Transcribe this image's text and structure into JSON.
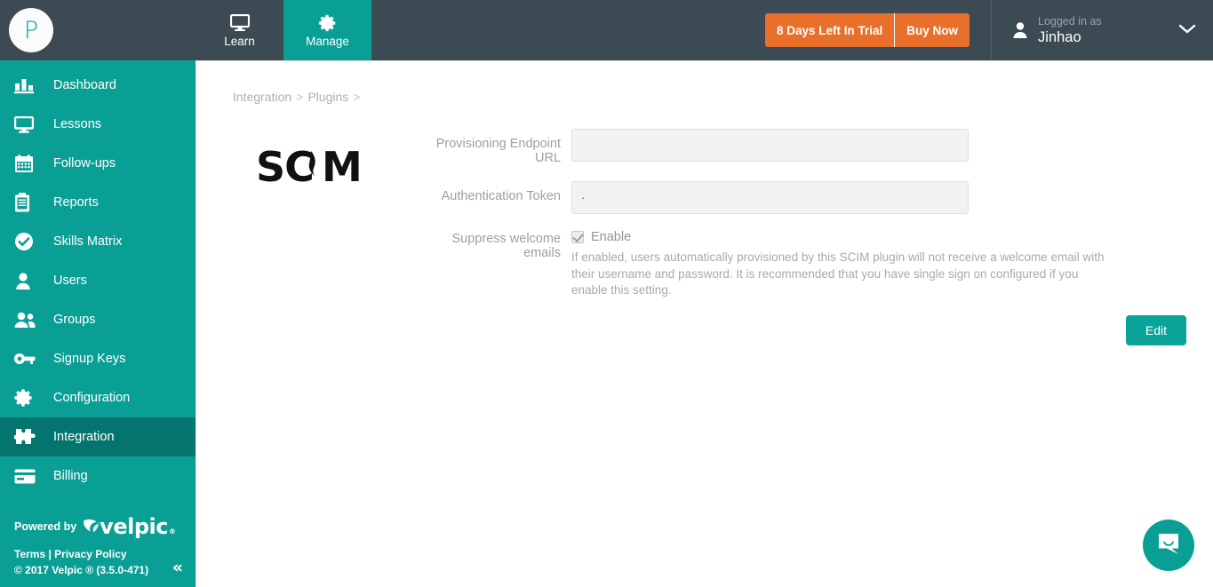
{
  "topbar": {
    "logo_letter": "P",
    "logo_name": "brand-logo-p",
    "nav": [
      {
        "label": "Learn",
        "icon": "monitor-icon",
        "active": false
      },
      {
        "label": "Manage",
        "icon": "gear-icon",
        "active": true
      }
    ],
    "trial": {
      "days_label": "8 Days Left In Trial",
      "buy_label": "Buy Now",
      "color": "#e8702a"
    },
    "user": {
      "logged_in_label": "Logged in as",
      "name": "Jinhao",
      "avatar_icon": "person-icon",
      "caret_icon": "chevron-down-icon"
    },
    "background_color": "#3c4b53"
  },
  "sidebar": {
    "accent_color": "#0a9f95",
    "active_color": "#04756e",
    "items": [
      {
        "label": "Dashboard",
        "icon": "bar-chart-icon",
        "active": false
      },
      {
        "label": "Lessons",
        "icon": "monitor-icon",
        "active": false
      },
      {
        "label": "Follow-ups",
        "icon": "calendar-icon",
        "active": false
      },
      {
        "label": "Reports",
        "icon": "clipboard-icon",
        "active": false
      },
      {
        "label": "Skills Matrix",
        "icon": "check-circle-icon",
        "active": false
      },
      {
        "label": "Users",
        "icon": "person-icon",
        "active": false
      },
      {
        "label": "Groups",
        "icon": "people-icon",
        "active": false
      },
      {
        "label": "Signup Keys",
        "icon": "key-icon",
        "active": false
      },
      {
        "label": "Configuration",
        "icon": "gear-icon",
        "active": false
      },
      {
        "label": "Integration",
        "icon": "puzzle-icon",
        "active": true
      },
      {
        "label": "Billing",
        "icon": "credit-card-icon",
        "active": false
      }
    ],
    "footer": {
      "powered_by": "Powered by",
      "brand": "velpic",
      "registered_mark": "®",
      "terms": "Terms",
      "links_separator": " | ",
      "privacy": "Privacy Policy",
      "copyright": "© 2017 Velpic ® (3.5.0-471)",
      "collapse_icon": "double-chevron-left-icon",
      "collapse_glyph": "«"
    }
  },
  "main": {
    "breadcrumb": {
      "items": [
        "Integration",
        "Plugins"
      ],
      "separator": ">"
    },
    "plugin": {
      "logo_text": "SCIM",
      "logo_name": "scim-logo"
    },
    "form": {
      "rows": [
        {
          "label": "Provisioning Endpoint URL",
          "value": "",
          "placeholder": "",
          "type": "text",
          "name": "provisioning-endpoint-url"
        },
        {
          "label": "Authentication Token",
          "value": "·",
          "placeholder": "",
          "type": "text",
          "name": "authentication-token"
        }
      ],
      "suppress": {
        "label": "Suppress welcome emails",
        "checkbox_label": "Enable",
        "checked": true,
        "help_text": "If enabled, users automatically provisioned by this SCIM plugin will not receive a welcome email with their username and password. It is recommended that you have single sign on configured if you enable this setting."
      },
      "edit_button": "Edit"
    }
  },
  "chat": {
    "launcher_icon": "chat-bubble-icon",
    "color": "#0a9f95"
  }
}
